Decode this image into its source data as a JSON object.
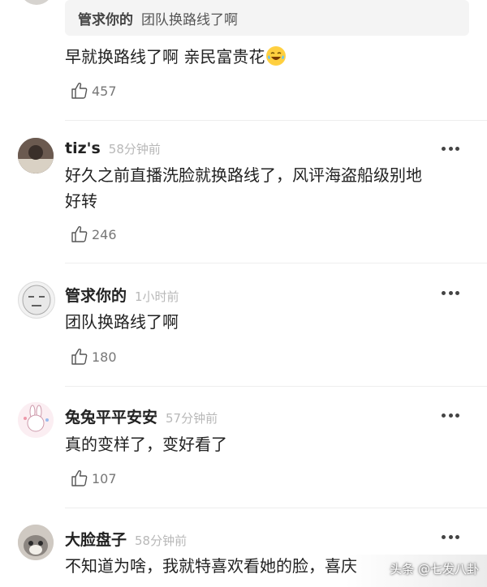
{
  "quoted_reply": {
    "author": "管求你的",
    "text": "团队换路线了啊"
  },
  "first_reply": {
    "text": "早就换路线了啊  亲民富贵花",
    "emoji_icon": "laughing-tears-emoji",
    "likes": "457"
  },
  "comments": [
    {
      "name": "tiz's",
      "time": "58分钟前",
      "text_line1": "好久之前直播洗脸就换路线了，风评海盗船级别地",
      "text_line2": "好转",
      "likes": "246"
    },
    {
      "name": "管求你的",
      "time": "1小时前",
      "text_line1": "团队换路线了啊",
      "likes": "180"
    },
    {
      "name": "兔兔平平安安",
      "time": "57分钟前",
      "text_line1": "真的变样了，变好看了",
      "likes": "107"
    },
    {
      "name": "大脸盘子",
      "time": "58分钟前",
      "text_line1": "不知道为啥，我就特喜欢看她的脸，喜庆"
    }
  ],
  "watermark": "头条 @七发八卦",
  "icons": {
    "like": "thumbs-up-icon",
    "more": "more-dots-icon"
  },
  "colors": {
    "time_gray": "#b8b8b8",
    "quote_bg": "#f4f4f4"
  }
}
